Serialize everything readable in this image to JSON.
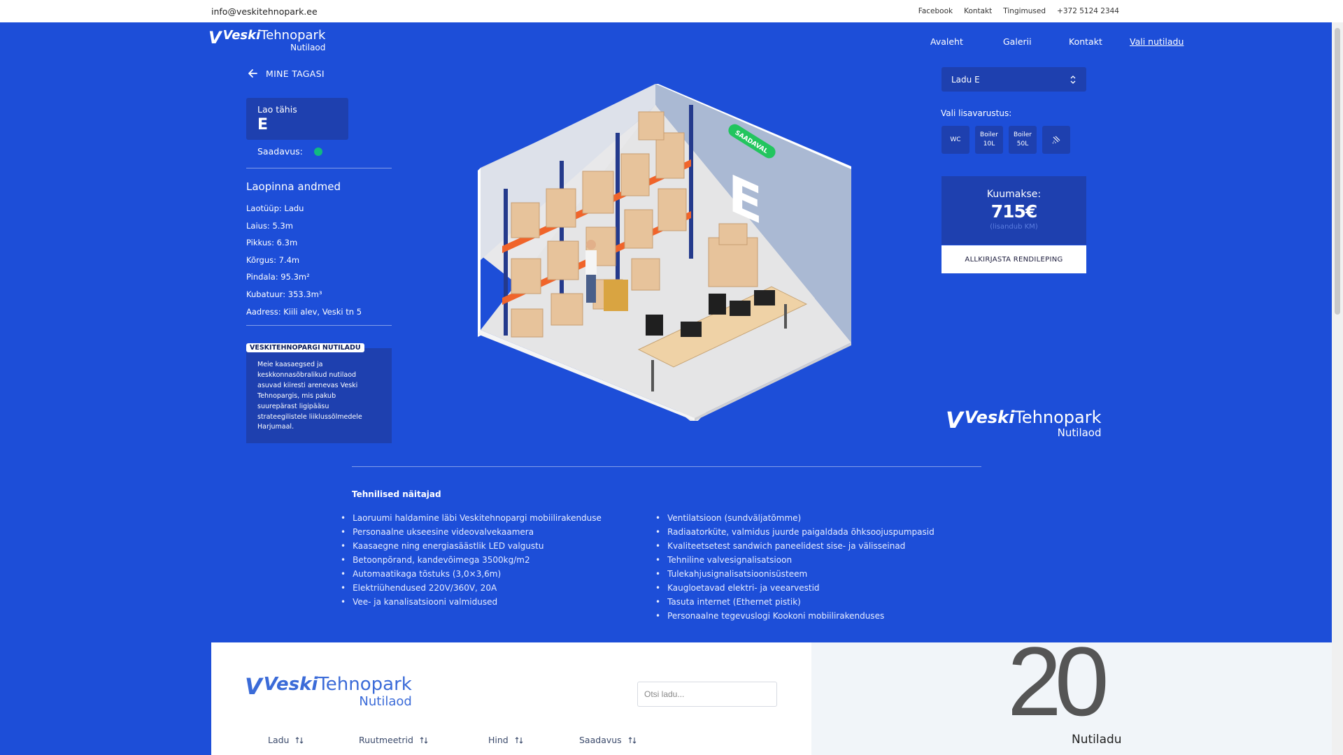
{
  "topbar": {
    "email": "info@veskitehnopark.ee",
    "links": [
      "Facebook",
      "Kontakt",
      "Tingimused",
      "+372 5124 2344"
    ]
  },
  "logo": {
    "mark": "V",
    "brand_bold": "Veski",
    "brand_rest": "Tehnopark",
    "sub": "Nutilaod"
  },
  "nav": {
    "items": [
      "Avaleht",
      "Galerii",
      "Kontakt",
      "Vali nutiladu"
    ],
    "active": "Vali nutiladu"
  },
  "left": {
    "back_label": "MINE TAGASI",
    "lao_label": "Lao tähis",
    "lao_value": "E",
    "saadavus_label": "Saadavus:",
    "saadavus_available": true,
    "section_title": "Laopinna andmed",
    "specs": [
      "Laotüüp: Ladu",
      "Laius: 5.3m",
      "Pikkus: 6.3m",
      "Kõrgus: 7.4m",
      "Pindala: 95.3m²",
      "Kubatuur: 353.3m³",
      "Aadress: Kiili alev, Veski tn 5"
    ],
    "info_tag": "VESKITEHNOPARGI NUTILADU",
    "info_text": "Meie kaasaegsed ja keskkonnasõbralikud nutilaod asuvad kiiresti arenevas Veski Tehnopargis, mis pakub suurepärast ligipääsu strateegilistele liiklussõlmedele Harjumaal."
  },
  "scene": {
    "badge": "SAADAVAL",
    "letter": "E"
  },
  "right": {
    "select_value": "Ladu E",
    "extras_label": "Vali lisavarustus:",
    "extras": [
      {
        "label": "WC"
      },
      {
        "label": "Boiler 10L"
      },
      {
        "label": "Boiler 50L"
      },
      {
        "label": "",
        "icon": "shower-icon"
      }
    ],
    "price_label": "Kuumakse:",
    "price_value": "715€",
    "price_note": "(lisandub KM)",
    "sign_button": "ALLKIRJASTA RENDILEPING"
  },
  "tech": {
    "title": "Tehnilised näitajad",
    "col1": [
      "Laoruumi haldamine läbi Veskitehnopargi mobiilirakenduse",
      "Personaalne ukseesine videovalvekaamera",
      "Kaasaegne ning energiasäästlik LED valgustu",
      "Betoonpõrand, kandevõimega 3500kg/m2",
      "Automaatikaga tõstuks (3,0×3,6m)",
      "Elektriühendused 220V/360V, 20A",
      "Vee- ja kanalisatsiooni valmidused"
    ],
    "col2": [
      "Ventilatsioon (sundväljatõmme)",
      "Radiaatorküte, valmidus juurde paigaldada õhksoojuspumpasid",
      "Kvaliteetsetest sandwich paneelidest sise- ja välisseinad",
      "Tehniline valvesignalisatsioon",
      "Tulekahjusignalisatsioonisüsteem",
      "Kaugloetavad elektri- ja veearvestid",
      "Tasuta internet (Ethernet pistik)",
      "Personaalne tegevuslogi Kookoni mobiilirakenduses"
    ]
  },
  "bottom": {
    "search_placeholder": "Otsi ladu...",
    "columns": [
      "Ladu",
      "Ruutmeetrid",
      "Hind",
      "Saadavus"
    ],
    "count": "20",
    "count_label": "Nutiladu"
  },
  "colors": {
    "brand_blue": "#1d4ed8",
    "card_blue": "#1e40af",
    "available_green": "#10b981"
  }
}
